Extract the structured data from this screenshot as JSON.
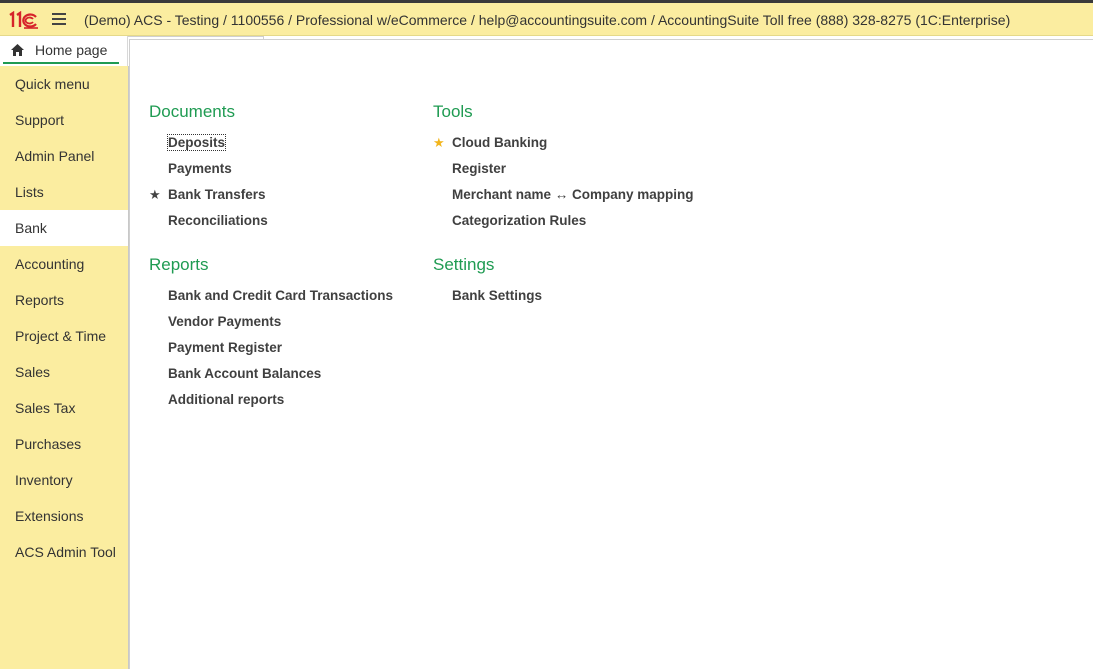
{
  "titlebar": {
    "title": "(Demo) ACS - Testing / 1100556 / Professional w/eCommerce / help@accountingsuite.com / AccountingSuite Toll free (888) 328-8275  (1C:Enterprise)"
  },
  "home_tab": {
    "label": "Home page"
  },
  "sidebar": {
    "items": [
      {
        "label": "Quick menu"
      },
      {
        "label": "Support"
      },
      {
        "label": "Admin Panel"
      },
      {
        "label": "Lists"
      },
      {
        "label": "Bank"
      },
      {
        "label": "Accounting"
      },
      {
        "label": "Reports"
      },
      {
        "label": "Project & Time"
      },
      {
        "label": "Sales"
      },
      {
        "label": "Sales Tax"
      },
      {
        "label": "Purchases"
      },
      {
        "label": "Inventory"
      },
      {
        "label": "Extensions"
      },
      {
        "label": "ACS Admin Tool"
      }
    ],
    "active_index": 4
  },
  "documents": {
    "title": "Documents",
    "items": [
      {
        "label": "Deposits"
      },
      {
        "label": "Payments"
      },
      {
        "label": "Bank Transfers",
        "star": "dark-star"
      },
      {
        "label": "Reconciliations"
      }
    ]
  },
  "reports": {
    "title": "Reports",
    "items": [
      {
        "label": "Bank and Credit Card Transactions"
      },
      {
        "label": "Vendor Payments"
      },
      {
        "label": "Payment Register"
      },
      {
        "label": "Bank Account Balances"
      },
      {
        "label": "Additional reports"
      }
    ]
  },
  "tools": {
    "title": "Tools",
    "items": [
      {
        "label": "Cloud Banking",
        "star": "gold-star"
      },
      {
        "label": "Register"
      },
      {
        "label": "Merchant name ↔ Company mapping"
      },
      {
        "label": "Categorization Rules"
      }
    ]
  },
  "settings": {
    "title": "Settings",
    "items": [
      {
        "label": "Bank Settings"
      }
    ]
  },
  "colors": {
    "titlebar_bg": "#fbeda0",
    "sidebar_bg": "#fbeda0",
    "section_title": "#1f9b52",
    "gold_star": "#f2b51c",
    "logo_red": "#d6232a"
  },
  "icons": {
    "logo": "1c-logo-icon",
    "menu": "hamburger-icon",
    "home": "home-icon",
    "favorite": "star-icon"
  }
}
